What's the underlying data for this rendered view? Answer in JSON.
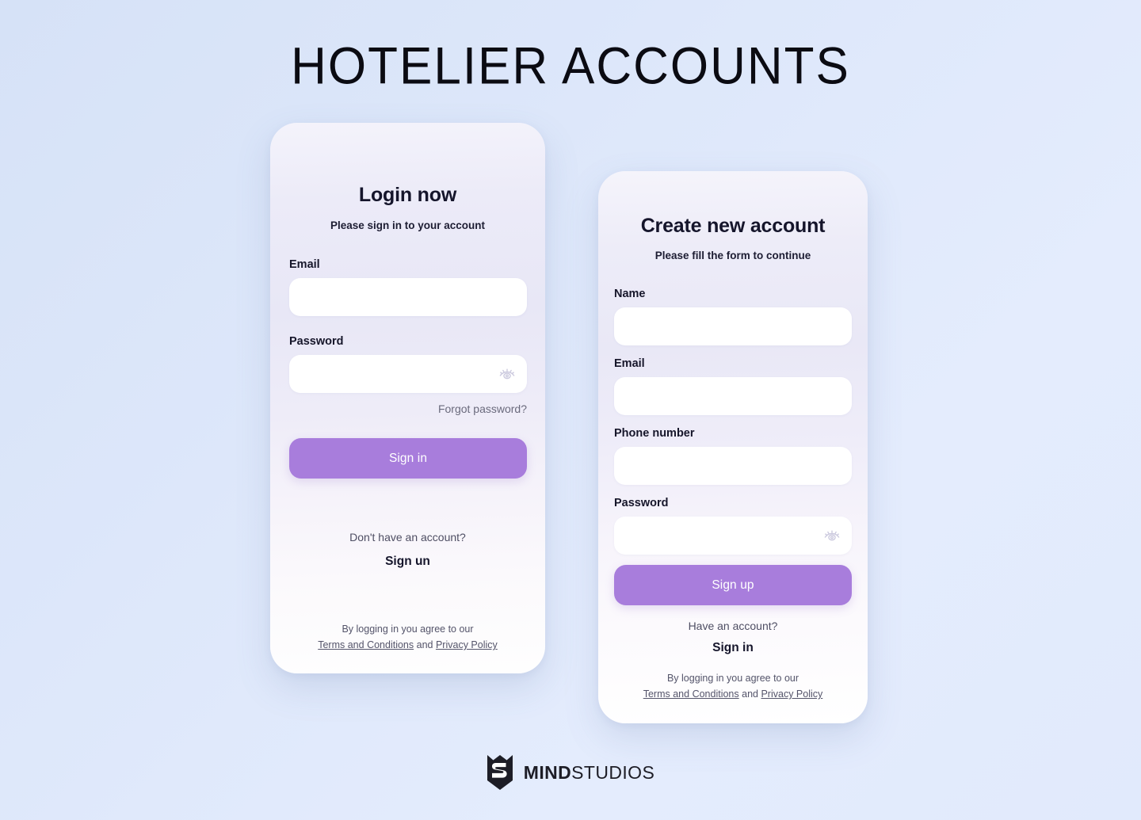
{
  "page": {
    "title": "HOTELIER ACCOUNTS"
  },
  "colors": {
    "background_start": "#d6e2f7",
    "background_end": "#e1eafc",
    "card_top": "#eae9f7",
    "card_bottom": "#ffffff",
    "primary_button": "#a87ddc",
    "heading": "#15152b",
    "muted_text": "#6a6a7c",
    "input_background": "#ffffff"
  },
  "login_card": {
    "title": "Login now",
    "subtitle": "Please sign in to your account",
    "fields": [
      {
        "label": "Email",
        "value": "",
        "placeholder": "",
        "type": "email",
        "has_eye": false
      },
      {
        "label": "Password",
        "value": "",
        "placeholder": "",
        "type": "password",
        "has_eye": true
      }
    ],
    "forgot_password": "Forgot password?",
    "submit_label": "Sign in",
    "switch_prompt": "Don't have an account?",
    "switch_action": "Sign un",
    "legal": {
      "line1": "By logging in you agree to our",
      "terms": "Terms and Conditions",
      "conjunction": "and",
      "privacy": "Privacy Policy"
    },
    "icons": {
      "password_toggle": "eye-icon"
    }
  },
  "signup_card": {
    "title": "Create new account",
    "subtitle": "Please fill the form to continue",
    "fields": [
      {
        "label": "Name",
        "value": "",
        "placeholder": "",
        "type": "text",
        "has_eye": false
      },
      {
        "label": "Email",
        "value": "",
        "placeholder": "",
        "type": "email",
        "has_eye": false
      },
      {
        "label": "Phone number",
        "value": "",
        "placeholder": "",
        "type": "tel",
        "has_eye": false
      },
      {
        "label": "Password",
        "value": "",
        "placeholder": "",
        "type": "password",
        "has_eye": true
      }
    ],
    "submit_label": "Sign up",
    "switch_prompt": "Have an account?",
    "switch_action": "Sign in",
    "legal": {
      "line1": "By logging in you agree to our",
      "terms": "Terms and Conditions",
      "conjunction": "and",
      "privacy": "Privacy Policy"
    },
    "icons": {
      "password_toggle": "eye-icon"
    }
  },
  "footer": {
    "brand_bold": "MIND",
    "brand_regular": "STUDIOS",
    "logo_icon": "mindstudios-logo-icon"
  }
}
